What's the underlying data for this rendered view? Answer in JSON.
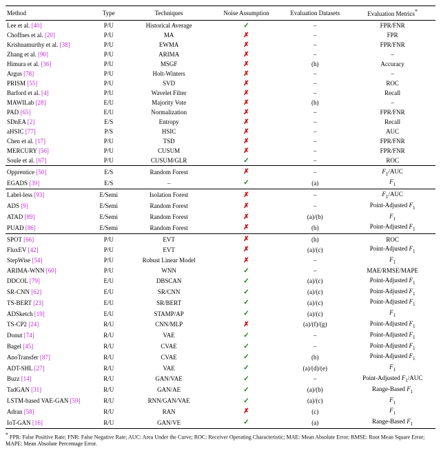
{
  "headers": {
    "method": "Method",
    "type": "Type",
    "techniques": "Techniques",
    "noise": "Noise Assumption",
    "evalds": "Evaluation Datasets",
    "metric": "Evaluation Metrics",
    "star": "*"
  },
  "groups": [
    {
      "rows": [
        {
          "name": "Lee et al.",
          "ref": "[40]",
          "type": "P/U",
          "tech": "Historical Average",
          "noise": true,
          "evalds": "–",
          "metric": "FPR/FNR"
        },
        {
          "name": "Choffnes et al.",
          "ref": "[20]",
          "type": "P/U",
          "tech": "MA",
          "noise": false,
          "evalds": "–",
          "metric": "FPR"
        },
        {
          "name": "Krishnamurthy et al.",
          "ref": "[38]",
          "type": "P/U",
          "tech": "EWMA",
          "noise": false,
          "evalds": "–",
          "metric": "FPR/FNR"
        },
        {
          "name": "Zhang et al.",
          "ref": "[90]",
          "type": "P/U",
          "tech": "ARIMA",
          "noise": false,
          "evalds": "–",
          "metric": "–"
        },
        {
          "name": "Himura et al.",
          "ref": "[36]",
          "type": "P/U",
          "tech": "MSGF",
          "noise": false,
          "evalds": "(h)",
          "metric": "Accuracy"
        },
        {
          "name": "Argus",
          "ref": "[78]",
          "type": "P/U",
          "tech": "Holt-Winters",
          "noise": false,
          "evalds": "–",
          "metric": "–"
        },
        {
          "name": "PRISM",
          "ref": "[55]",
          "type": "P/U",
          "tech": "SVD",
          "noise": false,
          "evalds": "–",
          "metric": "ROC"
        },
        {
          "name": "Barford et al.",
          "ref": "[4]",
          "type": "P/U",
          "tech": "Wavelet Filter",
          "noise": false,
          "evalds": "–",
          "metric": "Recall"
        },
        {
          "name": "MAWILab",
          "ref": "[28]",
          "type": "E/U",
          "tech": "Majority Vote",
          "noise": false,
          "evalds": "(h)",
          "metric": "–"
        },
        {
          "name": "PAD",
          "ref": "[65]",
          "type": "E/U",
          "tech": "Normalization",
          "noise": false,
          "evalds": "–",
          "metric": "FPR/FNR"
        },
        {
          "name": "SDnEA",
          "ref": "[2]",
          "type": "E/S",
          "tech": "Entropy",
          "noise": false,
          "evalds": "–",
          "metric": "Recall"
        },
        {
          "name": "aHSIC",
          "ref": "[77]",
          "type": "P/S",
          "tech": "HSIC",
          "noise": false,
          "evalds": "–",
          "metric": "AUC"
        },
        {
          "name": "Chen et al.",
          "ref": "[17]",
          "type": "P/U",
          "tech": "TSD",
          "noise": false,
          "evalds": "–",
          "metric": "FPR/FNR"
        },
        {
          "name": "MERCURY",
          "ref": "[56]",
          "type": "P/U",
          "tech": "CUSUM",
          "noise": false,
          "evalds": "–",
          "metric": "FPR/FNR"
        },
        {
          "name": "Soule et al.",
          "ref": "[67]",
          "type": "P/U",
          "tech": "CUSUM/GLR",
          "noise": true,
          "evalds": "–",
          "metric": "ROC"
        }
      ]
    },
    {
      "rows": [
        {
          "name": "Opprentice",
          "ref": "[50]",
          "type": "E/S",
          "tech": "Random Forest",
          "noise": false,
          "evalds": "–",
          "metric": "F₁/AUC"
        },
        {
          "name": "EGADS",
          "ref": "[39]",
          "type": "E/S",
          "tech": "–",
          "noise": true,
          "evalds": "(a)",
          "metric": "F₁"
        }
      ]
    },
    {
      "rows": [
        {
          "name": "Label-less",
          "ref": "[93]",
          "type": "E/Semi",
          "tech": "Isolation Forest",
          "noise": false,
          "evalds": "–",
          "metric": "F₁/AUC"
        },
        {
          "name": "ADS",
          "ref": "[9]",
          "type": "E/Semi",
          "tech": "Random Forest",
          "noise": false,
          "evalds": "–",
          "metric": "Point-Adjusted F₁"
        },
        {
          "name": "ATAD",
          "ref": "[89]",
          "type": "E/Semi",
          "tech": "Random Forest",
          "noise": false,
          "evalds": "(a)/(b)",
          "metric": "F₁"
        },
        {
          "name": "PUAD",
          "ref": "[86]",
          "type": "E/Semi",
          "tech": "Random Forest",
          "noise": false,
          "evalds": "(b)",
          "metric": "Point-Adjusted F₁"
        }
      ]
    },
    {
      "rows": [
        {
          "name": "SPOT",
          "ref": "[66]",
          "type": "P/U",
          "tech": "EVT",
          "noise": false,
          "evalds": "(h)",
          "metric": "ROC"
        },
        {
          "name": "FluxEV",
          "ref": "[42]",
          "type": "P/U",
          "tech": "EVT",
          "noise": false,
          "evalds": "(a)/(c)",
          "metric": "Point-Adjusted F₁"
        },
        {
          "name": "StepWise",
          "ref": "[54]",
          "type": "P/U",
          "tech": "Robust Linear Model",
          "noise": false,
          "evalds": "–",
          "metric": "F₁"
        },
        {
          "name": "ARIMA-WNN",
          "ref": "[60]",
          "type": "P/U",
          "tech": "WNN",
          "noise": true,
          "evalds": "–",
          "metric": "MAE/RMSE/MAPE"
        },
        {
          "name": "DDCOL",
          "ref": "[79]",
          "type": "E/U",
          "tech": "DBSCAN",
          "noise": true,
          "evalds": "(a)/(c)",
          "metric": "Point-Adjusted F₁"
        },
        {
          "name": "SR-CNN",
          "ref": "[62]",
          "type": "E/U",
          "tech": "SR/CNN",
          "noise": true,
          "evalds": "(a)/(c)",
          "metric": "Point-Adjusted F₁"
        },
        {
          "name": "TS-BERT",
          "ref": "[23]",
          "type": "E/U",
          "tech": "SR/BERT",
          "noise": true,
          "evalds": "(a)/(c)",
          "metric": "Point-Adjusted F₁"
        },
        {
          "name": "ADSketch",
          "ref": "[19]",
          "type": "E/U",
          "tech": "STAMP/AP",
          "noise": true,
          "evalds": "(a)/(c)",
          "metric": "F₁"
        },
        {
          "name": "TS-CP2",
          "ref": "[24]",
          "type": "R/U",
          "tech": "CNN/MLP",
          "noise": false,
          "evalds": "(a)/(f)/(g)",
          "metric": "Point-Adjusted F₁"
        },
        {
          "name": "Donut",
          "ref": "[74]",
          "type": "R/U",
          "tech": "VAE",
          "noise": true,
          "evalds": "–",
          "metric": "Point-Adjusted F₁"
        },
        {
          "name": "Bagel",
          "ref": "[45]",
          "type": "R/U",
          "tech": "CVAE",
          "noise": true,
          "evalds": "–",
          "metric": "Point-Adjusted F₁"
        },
        {
          "name": "AnoTransfer",
          "ref": "[87]",
          "type": "R/U",
          "tech": "CVAE",
          "noise": true,
          "evalds": "(b)",
          "metric": "Point-Adjusted F₁"
        },
        {
          "name": "ADT-SHL",
          "ref": "[27]",
          "type": "R/U",
          "tech": "VAE",
          "noise": true,
          "evalds": "(a)/(d)/(e)",
          "metric": "F₁"
        },
        {
          "name": "Buzz",
          "ref": "[14]",
          "type": "R/U",
          "tech": "GAN/VAE",
          "noise": true,
          "evalds": "–",
          "metric": "Point-Adjusted F₁/AUC"
        },
        {
          "name": "TadGAN",
          "ref": "[31]",
          "type": "R/U",
          "tech": "GAN/AE",
          "noise": true,
          "evalds": "(a)/(b)",
          "metric": "Range-Based F₁"
        },
        {
          "name": "LSTM-based VAE-GAN",
          "ref": "[59]",
          "type": "R/U",
          "tech": "RNN/GAN/VAE",
          "noise": true,
          "evalds": "(a)/(c)",
          "metric": "F₁"
        },
        {
          "name": "Adran",
          "ref": "[58]",
          "type": "R/U",
          "tech": "RAN",
          "noise": false,
          "evalds": "(c)",
          "metric": "F₁"
        },
        {
          "name": "IoT-GAN",
          "ref": "[16]",
          "type": "R/U",
          "tech": "GAN/VE",
          "noise": true,
          "evalds": "(a)",
          "metric": "Range-Based F₁"
        }
      ]
    }
  ],
  "footnote": "FPR: False Positive Rate; FNR: False Negative Rate; AUC: Area Under the Curve; ROC: Receiver Operating Characteristic; MAE: Mean Absolute Error; RMSE: Root Mean Square Error; MAPE: Mean Absolute Percentage Error.",
  "footstar": "*"
}
